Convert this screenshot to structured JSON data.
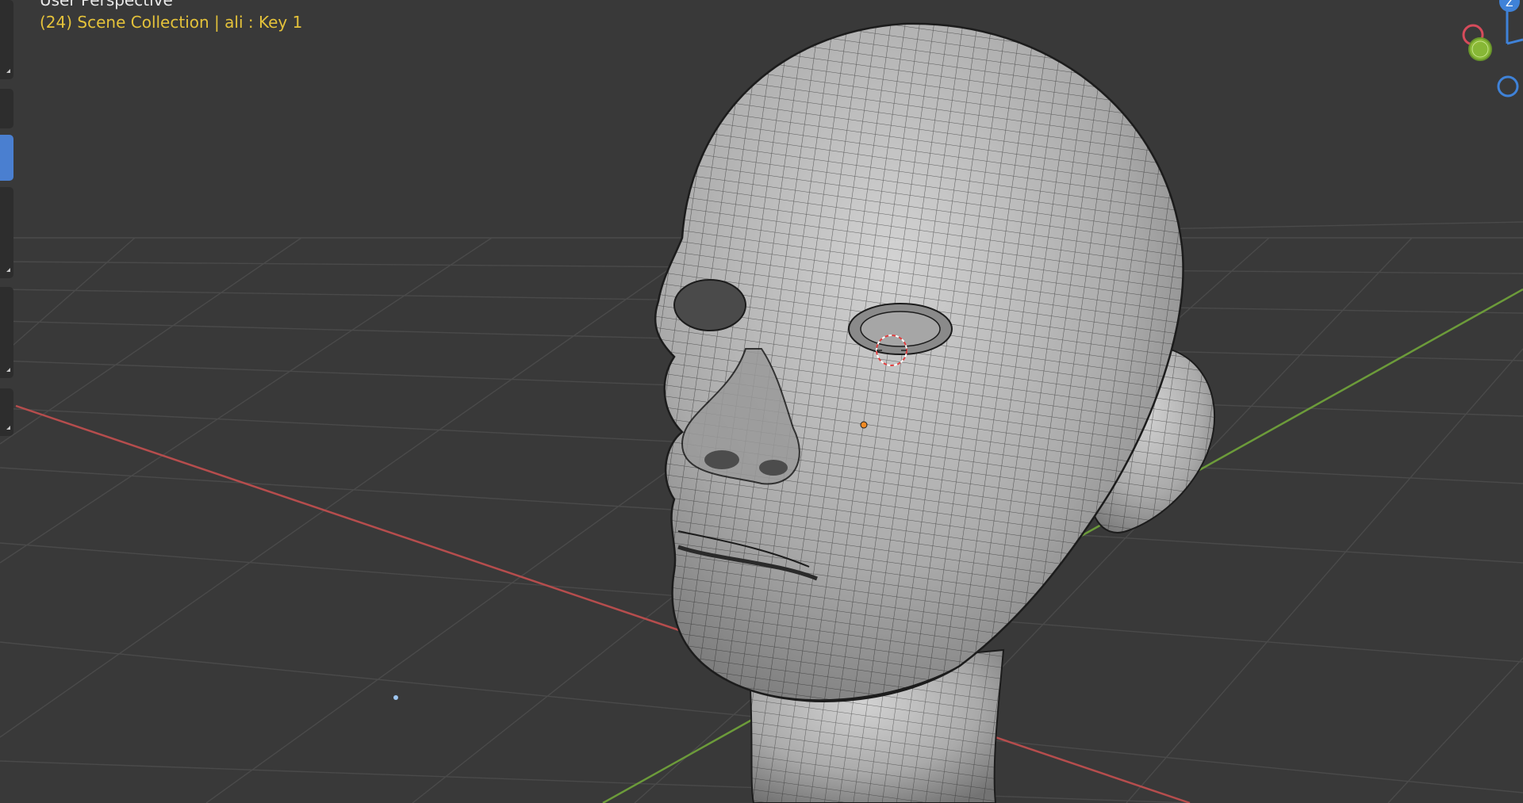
{
  "viewport": {
    "view_label": "User Perspective",
    "collection_label": "(24) Scene Collection | ali : Key 1"
  },
  "gizmo": {
    "axis_x_color": "#d74b5b",
    "axis_y_color": "#8cbe36",
    "axis_z_color": "#3f82d8",
    "z_label": "Z"
  },
  "colors": {
    "background": "#393939",
    "grid": "#4a4a4a",
    "x_axis": "#b64d4d",
    "y_axis": "#6c9b3a",
    "mesh_base": "#a5a5a5",
    "mesh_wire": "#1c1c1c",
    "active_tool": "#4a7fd0"
  },
  "icons": [
    "tool-move-icon",
    "tool-rotate-icon",
    "tool-active-icon",
    "tool-scale-icon",
    "tool-annotate-icon",
    "tool-measure-icon",
    "navigation-gizmo-icon",
    "3d-cursor-icon",
    "object-origin-icon",
    "light-icon"
  ]
}
